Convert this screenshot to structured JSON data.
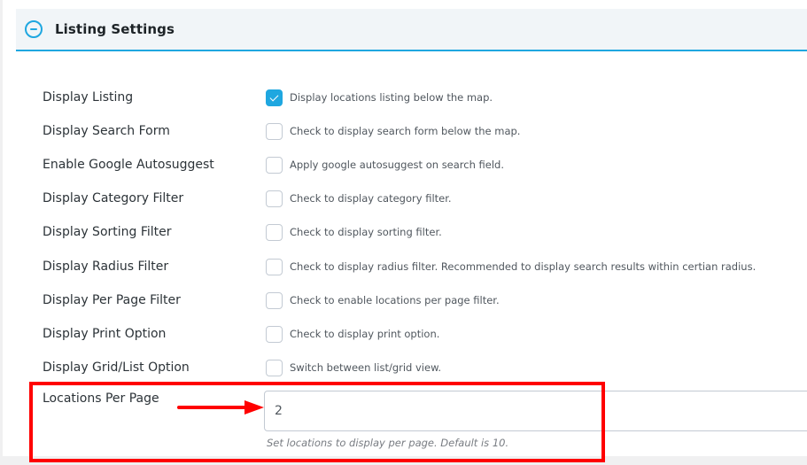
{
  "section": {
    "title": "Listing Settings",
    "toggle_icon": "minus-circle-icon",
    "accent_color": "#1fa7e0"
  },
  "settings": [
    {
      "label": "Display Listing",
      "checked": true,
      "description": "Display locations listing below the map."
    },
    {
      "label": "Display Search Form",
      "checked": false,
      "description": "Check to display search form below the map."
    },
    {
      "label": "Enable Google Autosuggest",
      "checked": false,
      "description": "Apply google autosuggest on search field."
    },
    {
      "label": "Display Category Filter",
      "checked": false,
      "description": "Check to display category filter."
    },
    {
      "label": "Display Sorting Filter",
      "checked": false,
      "description": "Check to display sorting filter."
    },
    {
      "label": "Display Radius Filter",
      "checked": false,
      "description": "Check to display radius filter. Recommended to display search results within certian radius."
    },
    {
      "label": "Display Per Page Filter",
      "checked": false,
      "description": "Check to enable locations per page filter."
    },
    {
      "label": "Display Print Option",
      "checked": false,
      "description": "Check to display print option."
    },
    {
      "label": "Display Grid/List Option",
      "checked": false,
      "description": "Switch between list/grid view."
    }
  ],
  "locations_per_page": {
    "label": "Locations Per Page",
    "value": "2",
    "help": "Set locations to display per page. Default is 10."
  },
  "annotation": {
    "highlight_color": "#ff0000",
    "arrow_icon": "red-arrow-right-icon"
  }
}
